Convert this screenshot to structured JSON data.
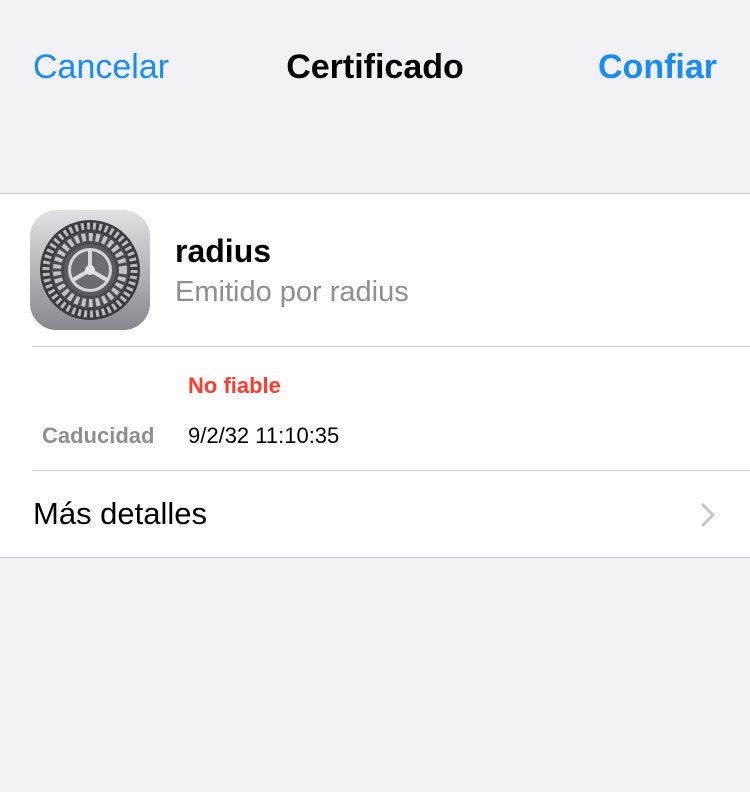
{
  "navbar": {
    "cancel_label": "Cancelar",
    "title": "Certificado",
    "confirm_label": "Confiar"
  },
  "certificate": {
    "icon": "settings-gear-icon",
    "name": "radius",
    "issuer": "Emitido por radius",
    "trust_status": "No fiable",
    "expiry_label": "Caducidad",
    "expiry_value": "9/2/32 11:10:35"
  },
  "more_details": {
    "label": "Más detalles",
    "icon": "chevron-right-icon"
  },
  "colors": {
    "accent": "#1a8cf5",
    "warning": "#fe3b30",
    "secondary_text": "#8e8e93",
    "background": "#f1f1f6"
  }
}
